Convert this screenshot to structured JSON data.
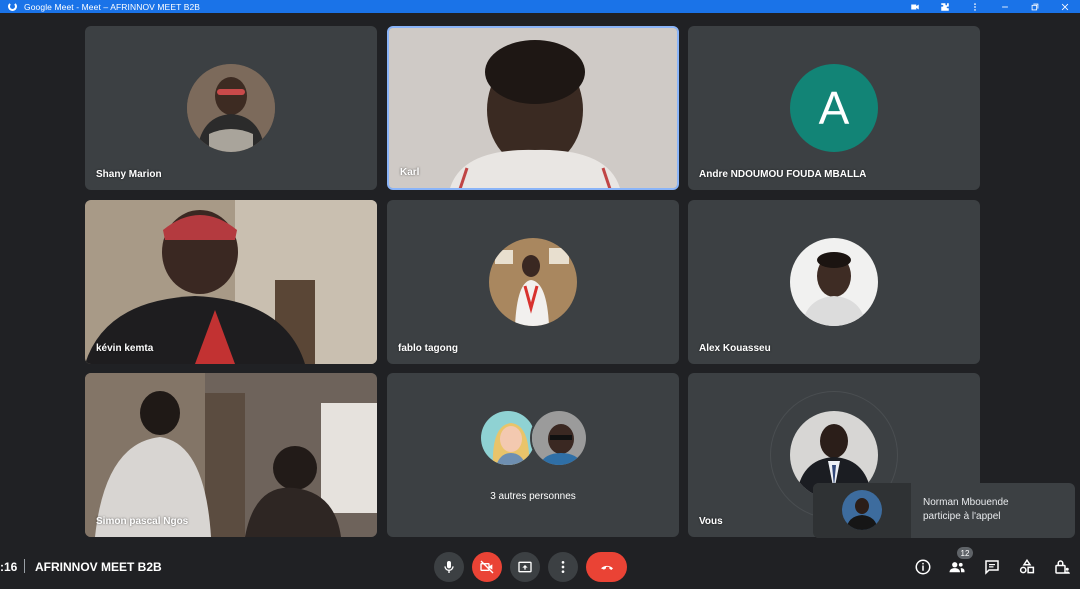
{
  "window": {
    "title": "Google Meet - Meet – AFRINNOV MEET B2B"
  },
  "tiles": [
    {
      "name": "Shany Marion",
      "kind": "avatar"
    },
    {
      "name": "Karl",
      "kind": "video"
    },
    {
      "name": "Andre NDOUMOU FOUDA MBALLA",
      "kind": "letter",
      "letter": "A",
      "color": "#128476"
    },
    {
      "name": "kévin kemta",
      "kind": "video"
    },
    {
      "name": "fablo tagong",
      "kind": "avatar"
    },
    {
      "name": "Alex Kouasseu",
      "kind": "avatar"
    },
    {
      "name": "Simon pascal Ngos",
      "kind": "video"
    },
    {
      "name": "3 autres personnes",
      "kind": "group"
    },
    {
      "name": "Vous",
      "kind": "self"
    }
  ],
  "bottombar": {
    "time": ":16",
    "meeting_code": "AFRINNOV MEET B2B",
    "participant_count": "12"
  },
  "toast": {
    "line1": "Norman Mbouende",
    "line2": "participe à l'appel"
  },
  "colors": {
    "background": "#202124",
    "tile": "#3c4043",
    "active_border": "#8ab4f8",
    "danger": "#ea4335",
    "titlebar": "#1a73e8"
  }
}
